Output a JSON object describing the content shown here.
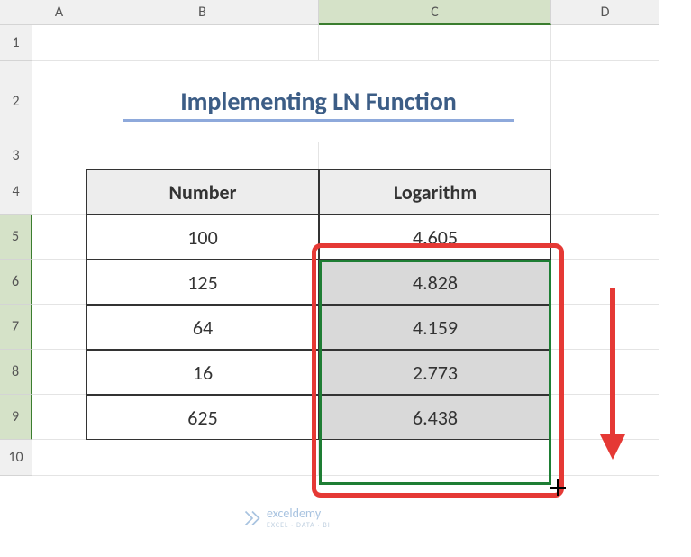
{
  "columns": [
    "A",
    "B",
    "C",
    "D"
  ],
  "rows": [
    "1",
    "2",
    "3",
    "4",
    "5",
    "6",
    "7",
    "8",
    "9",
    "10"
  ],
  "title": "Implementing LN Function",
  "headers": {
    "number": "Number",
    "logarithm": "Logarithm"
  },
  "chart_data": {
    "type": "table",
    "title": "Implementing LN Function",
    "columns": [
      "Number",
      "Logarithm"
    ],
    "rows": [
      {
        "number": 100,
        "logarithm": 4.605
      },
      {
        "number": 125,
        "logarithm": 4.828
      },
      {
        "number": 64,
        "logarithm": 4.159
      },
      {
        "number": 16,
        "logarithm": 2.773
      },
      {
        "number": 625,
        "logarithm": 6.438
      }
    ]
  },
  "watermark": {
    "text": "exceldemy",
    "sub": "EXCEL · DATA · BI"
  }
}
